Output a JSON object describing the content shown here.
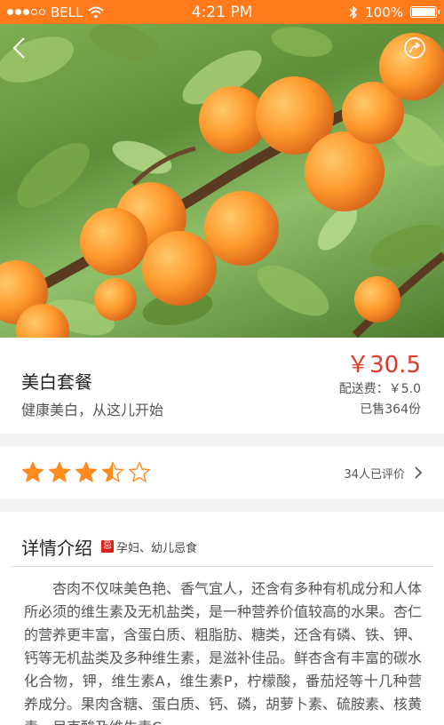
{
  "status_bar": {
    "carrier": "BELL",
    "time": "4:21 PM",
    "battery": "100%",
    "battery_level": 1.0,
    "signal_bars_filled": 3,
    "signal_bars_total": 5
  },
  "hero": {
    "image_icon": "apricot-photo",
    "back_icon": "back-chevron-icon",
    "share_icon": "share-icon"
  },
  "product": {
    "name": "美白套餐",
    "subtitle": "健康美白，从这儿开始",
    "price": "￥30.5",
    "shipping": "配送费：￥5.0",
    "sold": "已售364份"
  },
  "rating": {
    "value": 3.5,
    "max": 5,
    "count_text": "34人已评价",
    "star_color": "#ff8a1e"
  },
  "detail": {
    "title": "详情介绍",
    "warn_badge": "忌",
    "warn_text": "孕妇、幼儿忌食",
    "body": "杏肉不仅味美色艳、香气宜人，还含有多种有机成分和人体所必须的维生素及无机盐类，是一种营养价值较高的水果。杏仁的营养更丰富，含蛋白质、粗脂肪、糖类，还含有磷、铁、钾、钙等无机盐类及多种维生素，是滋补佳品。鲜杏含有丰富的碳水化合物，钾，维生素A，维生素P，柠檬酸，番茄烃等十几种营养成分。果肉含糖、蛋白质、钙、磷，胡萝卜素、硫胺素、核黄素、尼克酸及维生素C。"
  },
  "colors": {
    "accent": "#ff7a1a",
    "price": "#e23a2a"
  }
}
